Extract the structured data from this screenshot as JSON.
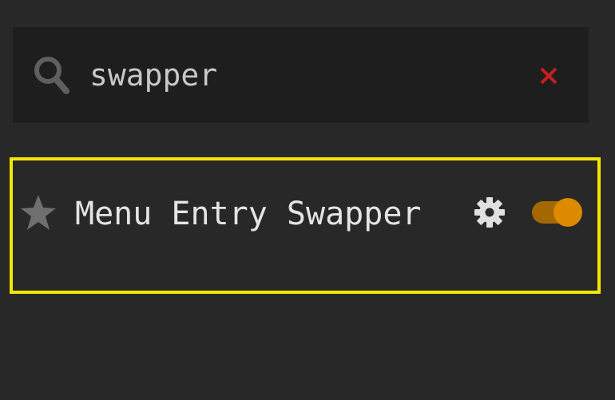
{
  "search": {
    "icon": "search-icon",
    "value": "swapper",
    "clear_icon": "close-icon"
  },
  "plugin": {
    "name": "Menu Entry Swapper",
    "favorite_icon": "star-icon",
    "settings_icon": "gear-icon",
    "enabled": true,
    "highlighted": true
  },
  "colors": {
    "background": "#282828",
    "search_background": "#1e1e1e",
    "highlight_border": "#f5e600",
    "toggle_on": "#dc8a00",
    "clear": "#c81e1e",
    "text": "#e4e4e4"
  }
}
